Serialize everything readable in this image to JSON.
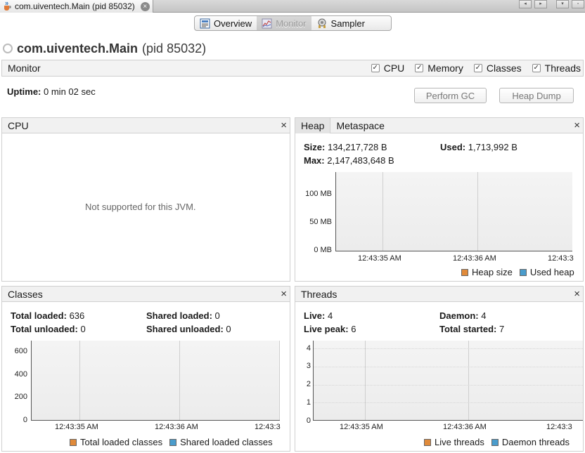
{
  "doc_tab": {
    "label": "com.uiventech.Main (pid 85032)",
    "close": "×"
  },
  "nav": {
    "prev": "◂",
    "next": "▸",
    "menu": "▾",
    "restore": "▫"
  },
  "views": [
    {
      "label": "Overview",
      "icon": "overview-icon",
      "active": false
    },
    {
      "label": "Monitor",
      "icon": "monitor-icon",
      "active": true
    },
    {
      "label": "Sampler",
      "icon": "sampler-icon",
      "active": false
    }
  ],
  "app": {
    "name": "com.uiventech.Main",
    "pid": "(pid 85032)"
  },
  "monitor": {
    "title": "Monitor",
    "checks": [
      {
        "label": "CPU",
        "checked": true
      },
      {
        "label": "Memory",
        "checked": true
      },
      {
        "label": "Classes",
        "checked": true
      },
      {
        "label": "Threads",
        "checked": true
      }
    ],
    "uptime_label": "Uptime:",
    "uptime_value": "0 min 02 sec",
    "perform_gc": "Perform GC",
    "heap_dump": "Heap Dump"
  },
  "cpu_panel": {
    "title": "CPU",
    "close": "×",
    "message": "Not supported for this JVM."
  },
  "heap_panel": {
    "tabs": [
      "Heap",
      "Metaspace"
    ],
    "close": "×",
    "size_label": "Size:",
    "size_value": "134,217,728 B",
    "used_label": "Used:",
    "used_value": "1,713,992 B",
    "max_label": "Max:",
    "max_value": "2,147,483,648 B",
    "legend": [
      "Heap size",
      "Used heap"
    ]
  },
  "classes_panel": {
    "title": "Classes",
    "close": "×",
    "total_loaded_label": "Total loaded:",
    "total_loaded_value": "636",
    "shared_loaded_label": "Shared loaded:",
    "shared_loaded_value": "0",
    "total_unloaded_label": "Total unloaded:",
    "total_unloaded_value": "0",
    "shared_unloaded_label": "Shared unloaded:",
    "shared_unloaded_value": "0",
    "legend": [
      "Total loaded classes",
      "Shared loaded classes"
    ]
  },
  "threads_panel": {
    "title": "Threads",
    "close": "×",
    "live_label": "Live:",
    "live_value": "4",
    "daemon_label": "Daemon:",
    "daemon_value": "4",
    "live_peak_label": "Live peak:",
    "live_peak_value": "6",
    "total_started_label": "Total started:",
    "total_started_value": "7",
    "legend": [
      "Live threads",
      "Daemon threads"
    ]
  },
  "colors": {
    "orange": "#e08a3a",
    "blue": "#4a9ccc"
  },
  "chart_data": [
    {
      "type": "line",
      "name": "heap",
      "y_ticks": [
        "100 MB",
        "50 MB",
        "0 MB"
      ],
      "x_ticks": [
        "12:43:35 AM",
        "12:43:36 AM",
        "12:43:3"
      ],
      "ylim": [
        0,
        120
      ],
      "series": [
        {
          "name": "Heap size",
          "values": []
        },
        {
          "name": "Used heap",
          "values": []
        }
      ],
      "grid": true
    },
    {
      "type": "line",
      "name": "classes",
      "y_ticks": [
        "600",
        "400",
        "200",
        "0"
      ],
      "x_ticks": [
        "12:43:35 AM",
        "12:43:36 AM",
        "12:43:3"
      ],
      "ylim": [
        0,
        680
      ],
      "series": [
        {
          "name": "Total loaded classes",
          "values": []
        },
        {
          "name": "Shared loaded classes",
          "values": []
        }
      ],
      "grid": true
    },
    {
      "type": "line",
      "name": "threads",
      "y_ticks": [
        "4",
        "3",
        "2",
        "1",
        "0"
      ],
      "x_ticks": [
        "12:43:35 AM",
        "12:43:36 AM",
        "12:43:3"
      ],
      "ylim": [
        0,
        4.3
      ],
      "series": [
        {
          "name": "Live threads",
          "values": []
        },
        {
          "name": "Daemon threads",
          "values": []
        }
      ],
      "grid": true
    }
  ]
}
